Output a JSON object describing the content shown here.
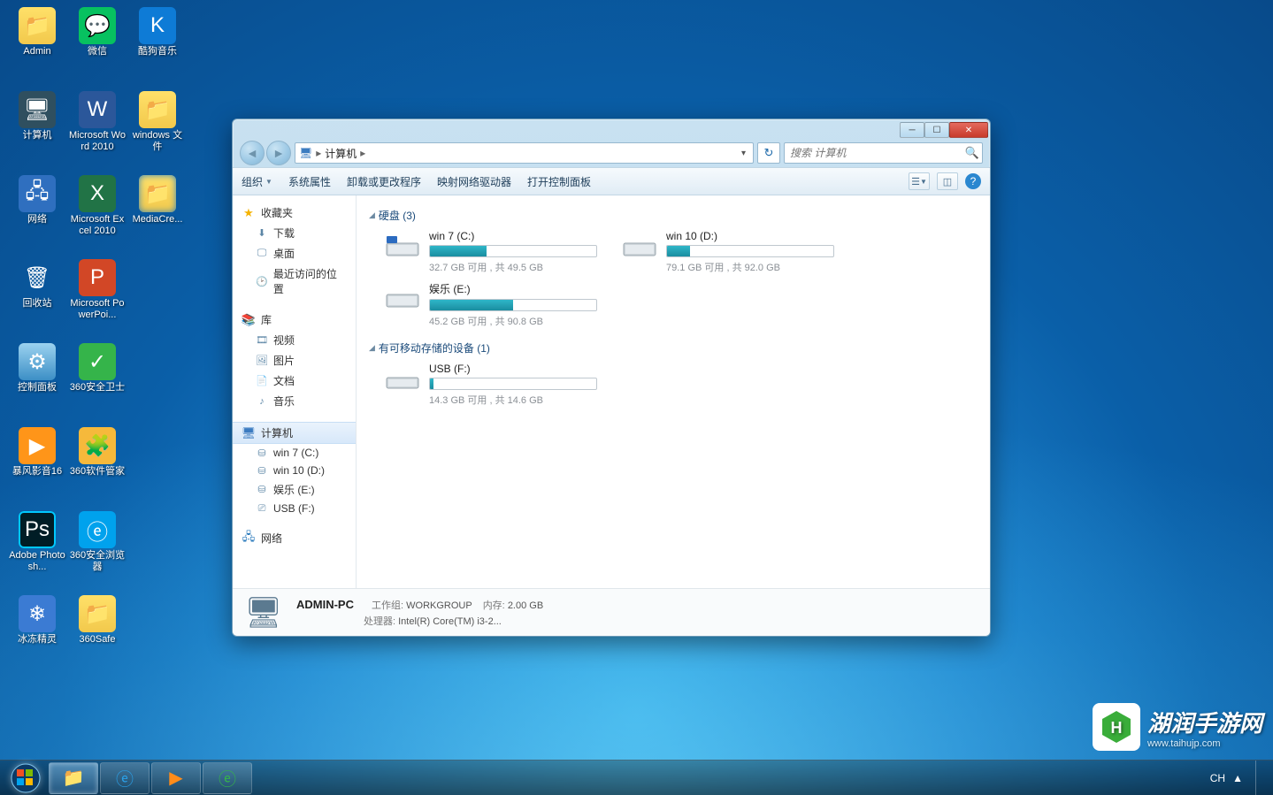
{
  "desktop_icons": [
    {
      "label": "Admin",
      "cls": "folder"
    },
    {
      "label": "微信",
      "cls": "wechat"
    },
    {
      "label": "酷狗音乐",
      "cls": "kugou"
    },
    {
      "label": "计算机",
      "cls": "comp"
    },
    {
      "label": "Microsoft Word 2010",
      "cls": "word"
    },
    {
      "label": "windows 文件",
      "cls": "folder"
    },
    {
      "label": "网络",
      "cls": "net"
    },
    {
      "label": "Microsoft Excel 2010",
      "cls": "excel"
    },
    {
      "label": "MediaCre...",
      "cls": "mcre"
    },
    {
      "label": "回收站",
      "cls": "recycle"
    },
    {
      "label": "Microsoft PowerPoi...",
      "cls": "ppt"
    },
    {
      "label": "",
      "cls": ""
    },
    {
      "label": "控制面板",
      "cls": "panel"
    },
    {
      "label": "360安全卫士",
      "cls": "green"
    },
    {
      "label": "",
      "cls": ""
    },
    {
      "label": "暴风影音16",
      "cls": "storm"
    },
    {
      "label": "360软件管家",
      "cls": "safe"
    },
    {
      "label": "",
      "cls": ""
    },
    {
      "label": "Adobe Photosh...",
      "cls": "ps"
    },
    {
      "label": "360安全浏览器",
      "cls": "ie"
    },
    {
      "label": "",
      "cls": ""
    },
    {
      "label": "冰冻精灵",
      "cls": "shield"
    },
    {
      "label": "360Safe",
      "cls": "folder"
    }
  ],
  "explorer": {
    "breadcrumb": {
      "root_icon": "computer",
      "label": "计算机"
    },
    "search_placeholder": "搜索 计算机",
    "cmdbar": {
      "organize": "组织",
      "props": "系统属性",
      "uninstall": "卸载或更改程序",
      "mapdrive": "映射网络驱动器",
      "controlpanel": "打开控制面板"
    },
    "sidebar": {
      "favorites": {
        "label": "收藏夹",
        "items": [
          {
            "label": "下载",
            "icon": "download"
          },
          {
            "label": "桌面",
            "icon": "desktop"
          },
          {
            "label": "最近访问的位置",
            "icon": "recent"
          }
        ]
      },
      "libraries": {
        "label": "库",
        "items": [
          {
            "label": "视频",
            "icon": "video"
          },
          {
            "label": "图片",
            "icon": "picture"
          },
          {
            "label": "文档",
            "icon": "doc"
          },
          {
            "label": "音乐",
            "icon": "music"
          }
        ]
      },
      "computer": {
        "label": "计算机",
        "items": [
          {
            "label": "win 7  (C:)",
            "icon": "hdd"
          },
          {
            "label": "win 10 (D:)",
            "icon": "hdd"
          },
          {
            "label": "娱乐 (E:)",
            "icon": "hdd"
          },
          {
            "label": "USB (F:)",
            "icon": "usb"
          }
        ]
      },
      "network": {
        "label": "网络"
      }
    },
    "sections": [
      {
        "title": "硬盘 (3)",
        "drives": [
          {
            "name": "win 7  (C:)",
            "sub": "32.7 GB 可用 , 共 49.5 GB",
            "pct": 34,
            "icon": "hdd-os"
          },
          {
            "name": "win 10 (D:)",
            "sub": "79.1 GB 可用 , 共 92.0 GB",
            "pct": 14,
            "icon": "hdd"
          },
          {
            "name": "娱乐 (E:)",
            "sub": "45.2 GB 可用 , 共 90.8 GB",
            "pct": 50,
            "icon": "hdd"
          }
        ]
      },
      {
        "title": "有可移动存储的设备 (1)",
        "drives": [
          {
            "name": "USB (F:)",
            "sub": "14.3 GB 可用 , 共 14.6 GB",
            "pct": 2,
            "icon": "usb"
          }
        ]
      }
    ],
    "details": {
      "name": "ADMIN-PC",
      "workgroup_lbl": "工作组:",
      "workgroup": "WORKGROUP",
      "mem_lbl": "内存:",
      "mem": "2.00 GB",
      "cpu_lbl": "处理器:",
      "cpu": "Intel(R) Core(TM) i3-2..."
    }
  },
  "taskbar": {
    "lang": "CH"
  },
  "watermark": {
    "title": "湖润手游网",
    "url": "www.taihujp.com"
  }
}
